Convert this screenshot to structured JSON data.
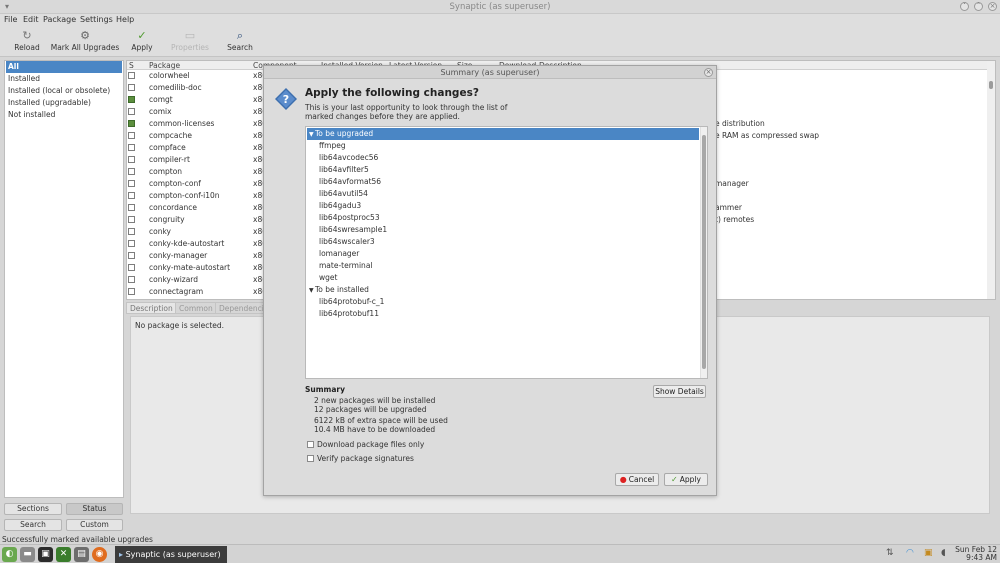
{
  "window": {
    "title": "Synaptic (as superuser)",
    "menu": [
      "File",
      "Edit",
      "Package",
      "Settings",
      "Help"
    ]
  },
  "toolbar": {
    "reload": "Reload",
    "mark_all": "Mark All Upgrades",
    "apply": "Apply",
    "properties": "Properties",
    "search": "Search"
  },
  "filters": {
    "items": [
      "All",
      "Installed",
      "Installed (local or obsolete)",
      "Installed (upgradable)",
      "Not installed"
    ],
    "buttons": [
      "Sections",
      "Status",
      "Search",
      "Custom"
    ]
  },
  "pkglist": {
    "columns": [
      "S",
      "Package",
      "Component",
      "Installed Version",
      "Latest Version",
      "Size",
      "Download",
      "Description"
    ],
    "rows": [
      {
        "name": "colorwheel",
        "comp": "x86",
        "desc": "",
        "installed": false
      },
      {
        "name": "comedilib-doc",
        "comp": "x86",
        "desc": "",
        "installed": false
      },
      {
        "name": "comgt",
        "comp": "x86",
        "desc": "",
        "installed": true
      },
      {
        "name": "comix",
        "comp": "x86",
        "desc": "",
        "installed": false
      },
      {
        "name": "common-licenses",
        "comp": "x86",
        "desc": "e distribution",
        "installed": true
      },
      {
        "name": "compcache",
        "comp": "x86",
        "desc": "e RAM as compressed swap",
        "installed": false
      },
      {
        "name": "compface",
        "comp": "x86",
        "desc": "",
        "installed": false
      },
      {
        "name": "compiler-rt",
        "comp": "x86",
        "desc": "",
        "installed": false
      },
      {
        "name": "compton",
        "comp": "x86",
        "desc": "",
        "installed": false
      },
      {
        "name": "compton-conf",
        "comp": "x86",
        "desc": "manager",
        "installed": false
      },
      {
        "name": "compton-conf-i10n",
        "comp": "x86",
        "desc": "",
        "installed": false
      },
      {
        "name": "concordance",
        "comp": "x86",
        "desc": "ammer",
        "installed": false
      },
      {
        "name": "congruity",
        "comp": "x86",
        "desc": "t) remotes",
        "installed": false
      },
      {
        "name": "conky",
        "comp": "x86",
        "desc": "",
        "installed": false
      },
      {
        "name": "conky-kde-autostart",
        "comp": "x86",
        "desc": "",
        "installed": false
      },
      {
        "name": "conky-manager",
        "comp": "x86",
        "desc": "",
        "installed": false
      },
      {
        "name": "conky-mate-autostart",
        "comp": "x86",
        "desc": "",
        "installed": false
      },
      {
        "name": "conky-wizard",
        "comp": "x86",
        "desc": "",
        "installed": false
      },
      {
        "name": "connectagram",
        "comp": "x86",
        "desc": "",
        "installed": false
      }
    ]
  },
  "details": {
    "tabs": [
      "Description",
      "Common",
      "Dependencies"
    ],
    "text": "No package is selected."
  },
  "statusbar": "Successfully marked available upgrades",
  "dialog": {
    "title": "Summary (as superuser)",
    "heading": "Apply the following changes?",
    "intro": "This is your last opportunity to look through the list of marked changes before they are applied.",
    "groups": [
      {
        "label": "To be upgraded",
        "items": [
          "ffmpeg",
          "lib64avcodec56",
          "lib64avfilter5",
          "lib64avformat56",
          "lib64avutil54",
          "lib64gadu3",
          "lib64postproc53",
          "lib64swresample1",
          "lib64swscaler3",
          "lomanager",
          "mate-terminal",
          "wget"
        ]
      },
      {
        "label": "To be installed",
        "items": [
          "lib64protobuf-c_1",
          "lib64protobuf11"
        ]
      }
    ],
    "summary_title": "Summary",
    "summary_lines": [
      "2 new packages will be installed",
      "12 packages will be upgraded",
      "6122 kB of extra space will be used",
      "10.4 MB have to be downloaded"
    ],
    "show_details": "Show Details",
    "download_only": "Download package files only",
    "verify": "Verify package signatures",
    "cancel": "Cancel",
    "apply": "Apply"
  },
  "taskbar": {
    "window_label": "Synaptic (as superuser)",
    "clock_day": "Sun Feb 12",
    "clock_time": "9:43 AM"
  }
}
